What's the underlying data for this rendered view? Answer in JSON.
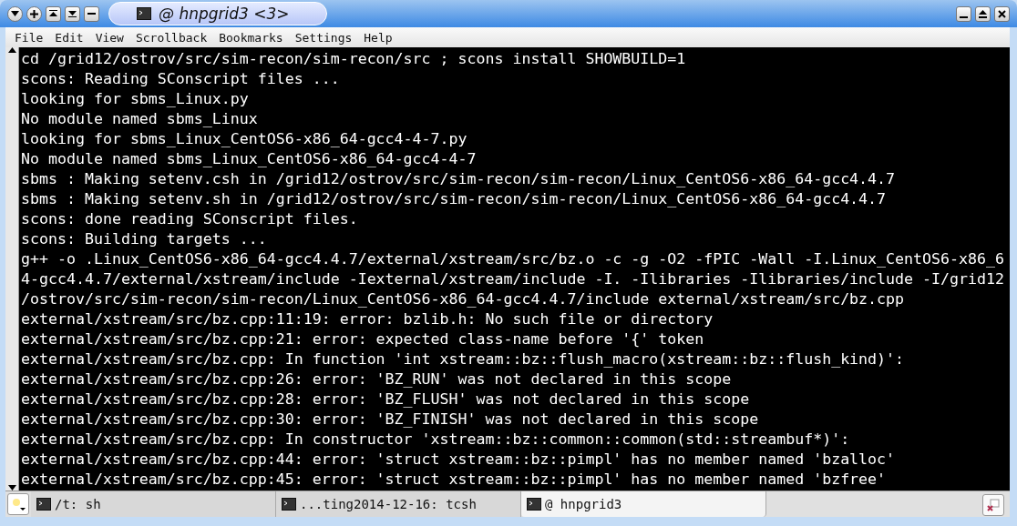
{
  "window": {
    "title": "@ hnpgrid3 <3>"
  },
  "menu": [
    "File",
    "Edit",
    "View",
    "Scrollback",
    "Bookmarks",
    "Settings",
    "Help"
  ],
  "terminal": {
    "lines": [
      "cd /grid12/ostrov/src/sim-recon/sim-recon/src ; scons install SHOWBUILD=1",
      "scons: Reading SConscript files ...",
      "looking for sbms_Linux.py",
      "No module named sbms_Linux",
      "looking for sbms_Linux_CentOS6-x86_64-gcc4-4-7.py",
      "No module named sbms_Linux_CentOS6-x86_64-gcc4-4-7",
      "sbms : Making setenv.csh in /grid12/ostrov/src/sim-recon/sim-recon/Linux_CentOS6-x86_64-gcc4.4.7",
      "sbms : Making setenv.sh in /grid12/ostrov/src/sim-recon/sim-recon/Linux_CentOS6-x86_64-gcc4.4.7",
      "scons: done reading SConscript files.",
      "scons: Building targets ...",
      "g++ -o .Linux_CentOS6-x86_64-gcc4.4.7/external/xstream/src/bz.o -c -g -O2 -fPIC -Wall -I.Linux_CentOS6-x86_6",
      "4-gcc4.4.7/external/xstream/include -Iexternal/xstream/include -I. -Ilibraries -Ilibraries/include -I/grid12",
      "/ostrov/src/sim-recon/sim-recon/Linux_CentOS6-x86_64-gcc4.4.7/include external/xstream/src/bz.cpp",
      "external/xstream/src/bz.cpp:11:19: error: bzlib.h: No such file or directory",
      "external/xstream/src/bz.cpp:21: error: expected class-name before '{' token",
      "external/xstream/src/bz.cpp: In function 'int xstream::bz::flush_macro(xstream::bz::flush_kind)':",
      "external/xstream/src/bz.cpp:26: error: 'BZ_RUN' was not declared in this scope",
      "external/xstream/src/bz.cpp:28: error: 'BZ_FLUSH' was not declared in this scope",
      "external/xstream/src/bz.cpp:30: error: 'BZ_FINISH' was not declared in this scope",
      "external/xstream/src/bz.cpp: In constructor 'xstream::bz::common::common(std::streambuf*)':",
      "external/xstream/src/bz.cpp:44: error: 'struct xstream::bz::pimpl' has no member named 'bzalloc'",
      "external/xstream/src/bz.cpp:45: error: 'struct xstream::bz::pimpl' has no member named 'bzfree'"
    ]
  },
  "tabs": [
    {
      "label": "/t: sh",
      "selected": false
    },
    {
      "label": "...ting2014-12-16: tcsh",
      "selected": false
    },
    {
      "label": "@ hnpgrid3",
      "selected": true
    }
  ]
}
